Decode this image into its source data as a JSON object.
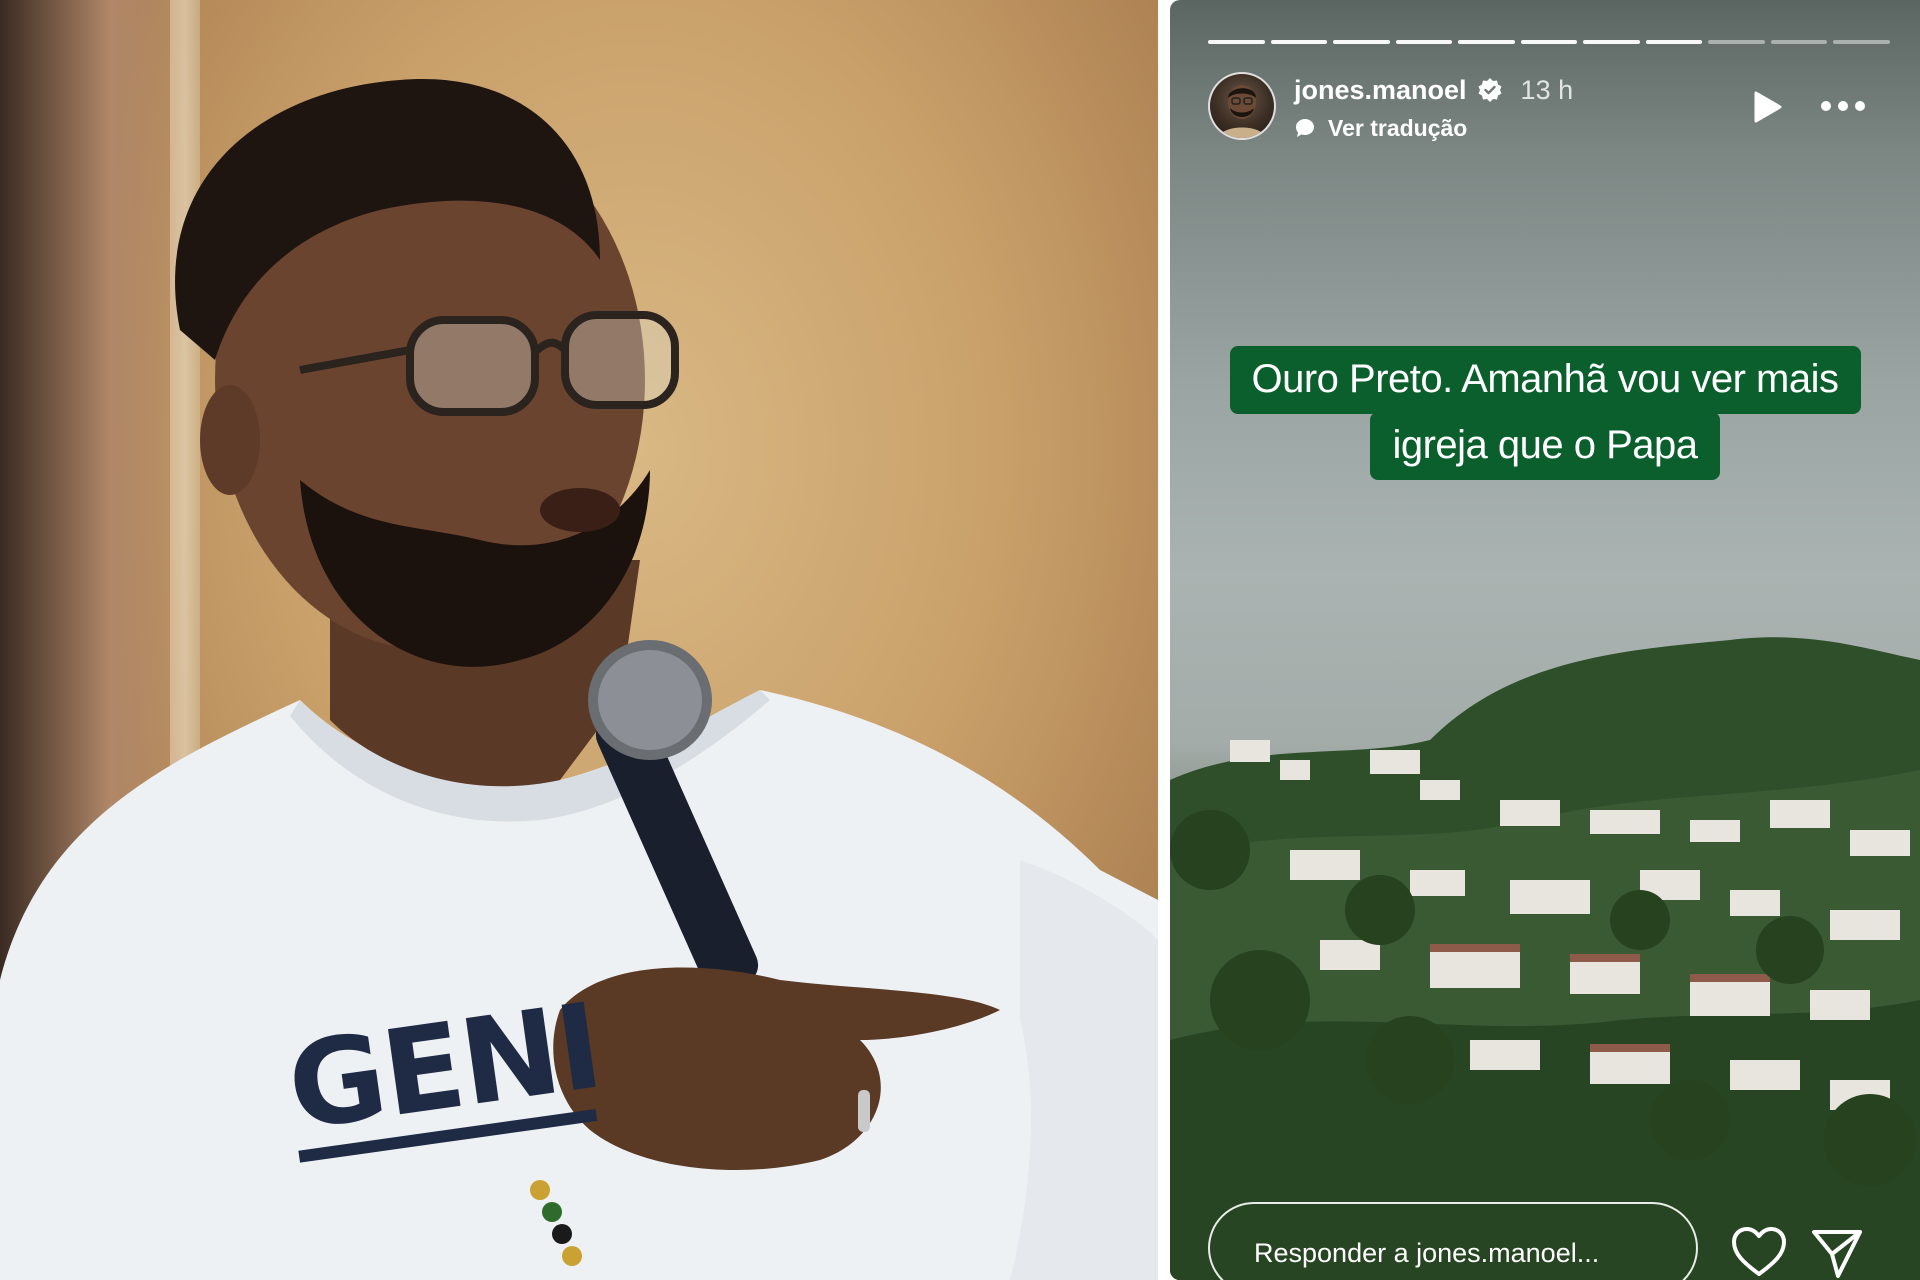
{
  "story": {
    "progress_total": 11,
    "progress_done": 8,
    "username": "jones.manoel",
    "time": "13 h",
    "translate_label": "Ver tradução",
    "caption": {
      "line1": "Ouro Preto. Amanhã vou ver mais",
      "line2": "igreja que o Papa"
    },
    "reply_placeholder": "Responder a jones.manoel...",
    "icons": [
      "verified-icon",
      "translate-icon",
      "play-icon",
      "more-icon",
      "heart-icon",
      "send-icon"
    ]
  },
  "photo": {
    "shirt_text": "GENI"
  },
  "colors": {
    "caption_bg": "#0a5f2c",
    "shirt": "#eef1f4",
    "shirt_print": "#1f2a44"
  }
}
